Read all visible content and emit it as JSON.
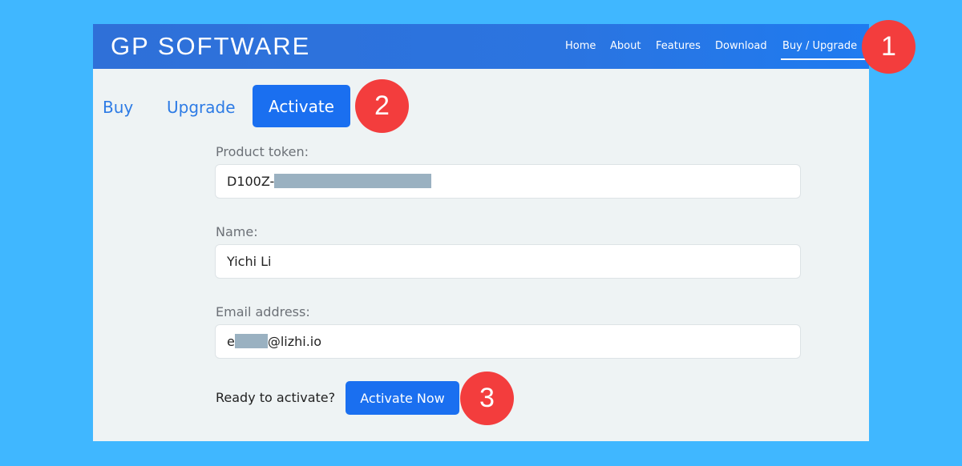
{
  "header": {
    "brand": "GP SOFTWARE",
    "nav": [
      "Home",
      "About",
      "Features",
      "Download",
      "Buy / Upgrade"
    ],
    "active_nav": "Buy / Upgrade"
  },
  "tabs": {
    "buy": "Buy",
    "upgrade": "Upgrade",
    "activate": "Activate"
  },
  "form": {
    "token_label": "Product token:",
    "token_value": "D100Z-",
    "name_label": "Name:",
    "name_value": "Yichi Li",
    "email_label": "Email address:",
    "email_prefix": "e",
    "email_suffix": "@lizhi.io",
    "ready_text": "Ready to activate?",
    "activate_now": "Activate Now"
  },
  "callouts": [
    "1",
    "2",
    "3"
  ],
  "colors": {
    "background": "#40b7ff",
    "header": "#2b74e0",
    "primary_button": "#1a6ff0",
    "callout": "#f33d3d",
    "content_bg": "#eef3f4"
  }
}
